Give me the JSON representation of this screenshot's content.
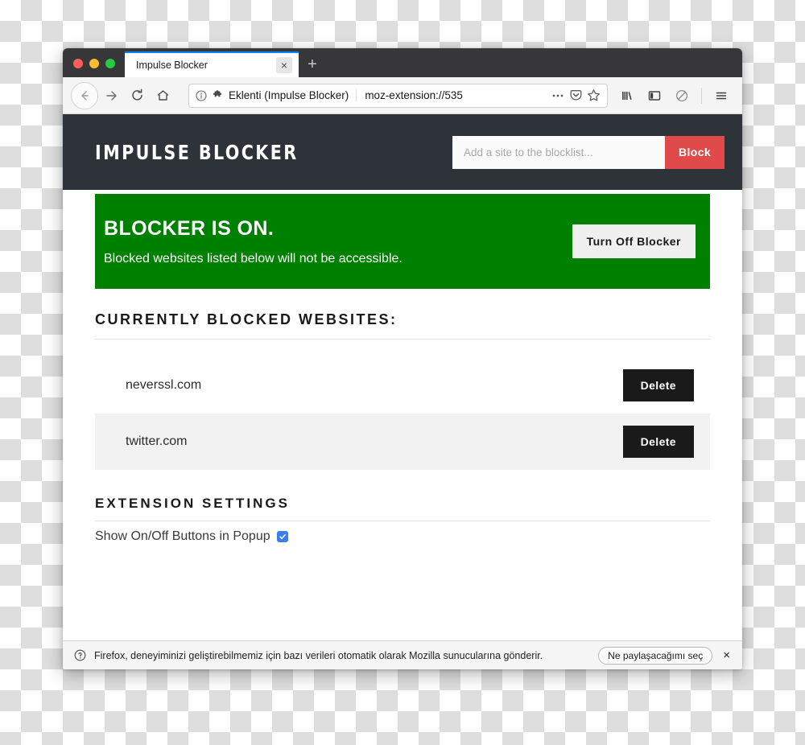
{
  "window": {
    "traffic_lights": [
      "close",
      "minimize",
      "maximize"
    ],
    "tab": {
      "title": "Impulse Blocker",
      "close_label": "×"
    },
    "new_tab_label": "+"
  },
  "toolbar": {
    "back_icon": "back-arrow-icon",
    "forward_icon": "forward-arrow-icon",
    "reload_icon": "reload-icon",
    "home_icon": "home-icon",
    "identity_label": "Eklenti (Impulse Blocker)",
    "url": "moz-extension://535",
    "page_actions_icon": "ellipsis-icon",
    "pocket_icon": "pocket-icon",
    "bookmark_icon": "star-icon",
    "library_icon": "library-icon",
    "sidebar_icon": "sidebar-icon",
    "blocked_icon": "no-entry-icon",
    "menu_icon": "hamburger-menu-icon"
  },
  "extension": {
    "title": "IMPULSE BLOCKER",
    "add_site": {
      "placeholder": "Add a site to the blocklist...",
      "value": "",
      "button_label": "Block"
    },
    "status": {
      "heading": "BLOCKER IS ON.",
      "description": "Blocked websites listed below will not be accessible.",
      "toggle_label": "Turn Off Blocker",
      "banner_color": "#008000"
    },
    "blocklist": {
      "section_title": "CURRENTLY BLOCKED WEBSITES:",
      "delete_label": "Delete",
      "sites": [
        {
          "name": "neverssl.com"
        },
        {
          "name": "twitter.com"
        }
      ]
    },
    "settings": {
      "section_title": "EXTENSION SETTINGS",
      "options": [
        {
          "label": "Show On/Off Buttons in Popup",
          "checked": true
        }
      ]
    }
  },
  "notification": {
    "info_icon": "question-circle-icon",
    "message": "Firefox, deneyiminizi geliştirebilmemiz için bazı verileri otomatik olarak Mozilla sunucularına gönderir.",
    "choose_label": "Ne paylaşacağımı seç",
    "close_label": "×"
  },
  "colors": {
    "header_bg": "#2e333a",
    "accent_red": "#e04a4a",
    "status_green": "#008000",
    "checkbox_blue": "#3b7ded"
  }
}
